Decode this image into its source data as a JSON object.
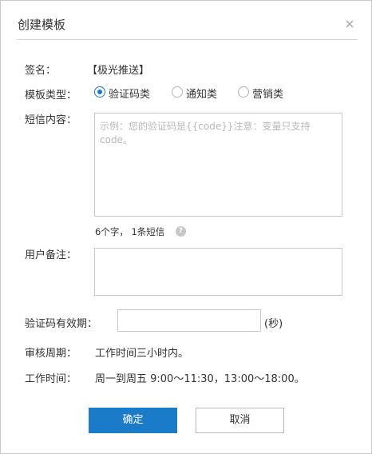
{
  "dialog": {
    "title": "创建模板",
    "close_icon": "close-icon"
  },
  "form": {
    "signature": {
      "label": "签名：",
      "value": "【极光推送】"
    },
    "template_type": {
      "label": "模板类型：",
      "options": [
        {
          "label": "验证码类",
          "checked": true
        },
        {
          "label": "通知类",
          "checked": false
        },
        {
          "label": "营销类",
          "checked": false
        }
      ]
    },
    "sms_content": {
      "label": "短信内容：",
      "value": "",
      "placeholder": "示例：您的验证码是{{code}}注意：变量只支持code。"
    },
    "counter": {
      "text": "6个字， 1条短信",
      "help_icon": "help-icon",
      "help_glyph": "?"
    },
    "remark": {
      "label": "用户备注：",
      "value": "",
      "placeholder": ""
    },
    "validity": {
      "label": "验证码有效期：",
      "value": "",
      "unit": "(秒)"
    },
    "review_period": {
      "label": "审核周期：",
      "value": "工作时间三小时内。"
    },
    "work_time": {
      "label": "工作时间：",
      "value": "周一到周五 9:00～11:30，13:00～18:00。"
    }
  },
  "buttons": {
    "confirm": "确定",
    "cancel": "取消"
  },
  "colors": {
    "primary": "#1a7bc9",
    "border": "#c9c9c9"
  }
}
